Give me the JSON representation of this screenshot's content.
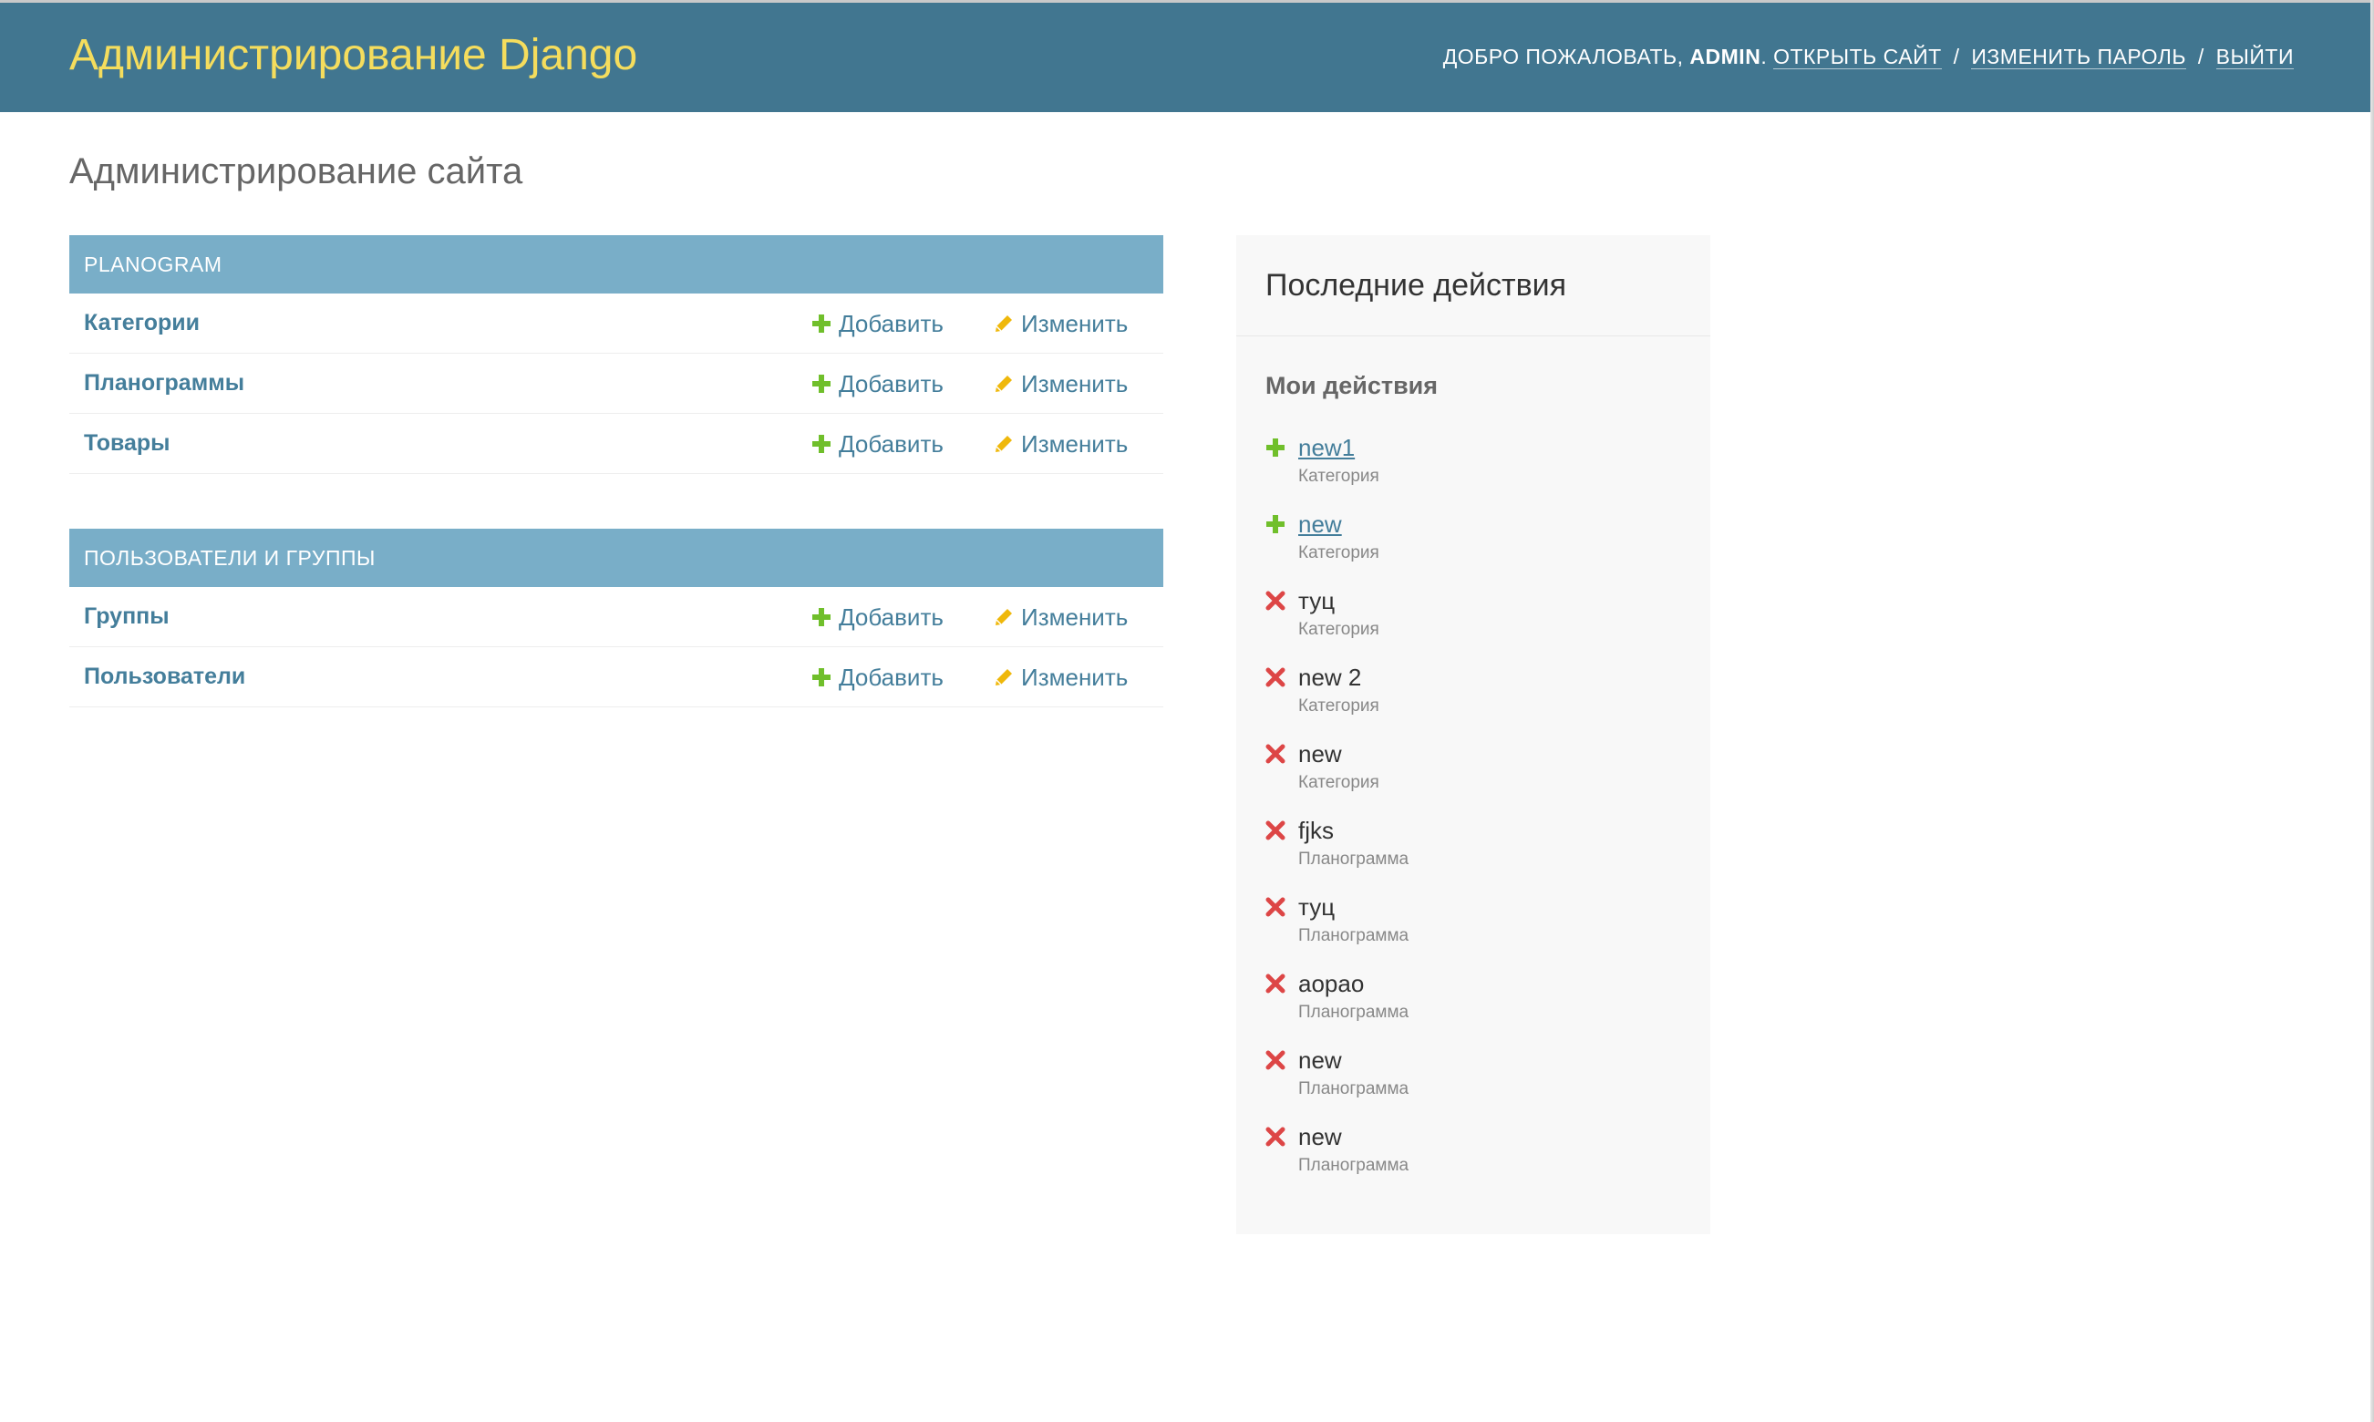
{
  "header": {
    "brand": "Администрирование Django",
    "welcome": "ДОБРО ПОЖАЛОВАТЬ,",
    "username": "ADMIN",
    "view_site": "ОТКРЫТЬ САЙТ",
    "change_password": "ИЗМЕНИТЬ ПАРОЛЬ",
    "logout": "ВЫЙТИ",
    "separator": "/"
  },
  "page_title": "Администрирование сайта",
  "modules": [
    {
      "caption": "PLANOGRAM",
      "rows": [
        {
          "name": "Категории",
          "add": "Добавить",
          "change": "Изменить"
        },
        {
          "name": "Планограммы",
          "add": "Добавить",
          "change": "Изменить"
        },
        {
          "name": "Товары",
          "add": "Добавить",
          "change": "Изменить"
        }
      ]
    },
    {
      "caption": "ПОЛЬЗОВАТЕЛИ И ГРУППЫ",
      "rows": [
        {
          "name": "Группы",
          "add": "Добавить",
          "change": "Изменить"
        },
        {
          "name": "Пользователи",
          "add": "Добавить",
          "change": "Изменить"
        }
      ]
    }
  ],
  "recent_actions": {
    "title": "Последние действия",
    "subtitle": "Мои действия",
    "items": [
      {
        "name": "new1",
        "type": "Категория",
        "action": "added",
        "icon": "plus-icon"
      },
      {
        "name": "new",
        "type": "Категория",
        "action": "added",
        "icon": "plus-icon"
      },
      {
        "name": "туц",
        "type": "Категория",
        "action": "deleted",
        "icon": "delete-icon"
      },
      {
        "name": "new 2",
        "type": "Категория",
        "action": "deleted",
        "icon": "delete-icon"
      },
      {
        "name": "new",
        "type": "Категория",
        "action": "deleted",
        "icon": "delete-icon"
      },
      {
        "name": "fjks",
        "type": "Планограмма",
        "action": "deleted",
        "icon": "delete-icon"
      },
      {
        "name": "туц",
        "type": "Планограмма",
        "action": "deleted",
        "icon": "delete-icon"
      },
      {
        "name": "aopao",
        "type": "Планограмма",
        "action": "deleted",
        "icon": "delete-icon"
      },
      {
        "name": "new",
        "type": "Планограмма",
        "action": "deleted",
        "icon": "delete-icon"
      },
      {
        "name": "new",
        "type": "Планограмма",
        "action": "deleted",
        "icon": "delete-icon"
      }
    ]
  },
  "colors": {
    "header_bg": "#417690",
    "brand": "#f5dd5d",
    "module_caption_bg": "#79aec8",
    "link": "#447e9b",
    "add_icon": "#70bf2b",
    "change_icon": "#efb80b",
    "delete_icon": "#dd4646"
  }
}
